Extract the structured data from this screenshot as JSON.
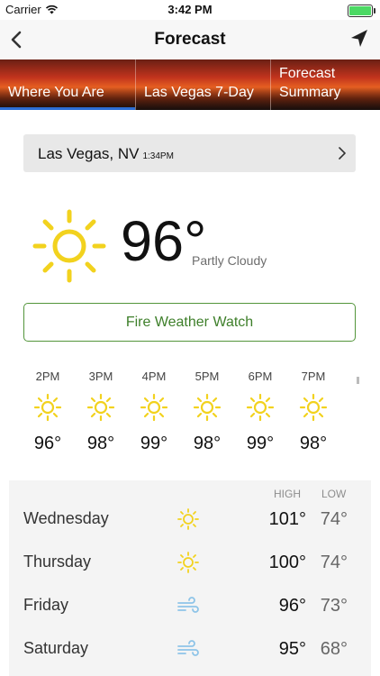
{
  "status": {
    "carrier": "Carrier",
    "time": "3:42 PM"
  },
  "nav": {
    "title": "Forecast"
  },
  "tabs": [
    {
      "label": "Where You Are",
      "active": true
    },
    {
      "label": "Las Vegas 7-Day",
      "active": false
    },
    {
      "label": "Forecast\nSummary",
      "active": false
    }
  ],
  "location": {
    "name": "Las Vegas, NV",
    "time": "1:34PM"
  },
  "current": {
    "temp": "96°",
    "condition": "Partly Cloudy",
    "icon": "sun-icon"
  },
  "alert": {
    "label": "Fire Weather Watch"
  },
  "hourly": [
    {
      "time": "2PM",
      "temp": "96°",
      "icon": "sun-icon"
    },
    {
      "time": "3PM",
      "temp": "98°",
      "icon": "sun-icon"
    },
    {
      "time": "4PM",
      "temp": "99°",
      "icon": "sun-icon"
    },
    {
      "time": "5PM",
      "temp": "98°",
      "icon": "sun-icon"
    },
    {
      "time": "6PM",
      "temp": "99°",
      "icon": "sun-icon"
    },
    {
      "time": "7PM",
      "temp": "98°",
      "icon": "sun-icon"
    }
  ],
  "daily_header": {
    "high": "HIGH",
    "low": "LOW"
  },
  "daily": [
    {
      "day": "Wednesday",
      "high": "101°",
      "low": "74°",
      "icon": "sun-icon"
    },
    {
      "day": "Thursday",
      "high": "100°",
      "low": "74°",
      "icon": "sun-icon"
    },
    {
      "day": "Friday",
      "high": "96°",
      "low": "73°",
      "icon": "wind-icon"
    },
    {
      "day": "Saturday",
      "high": "95°",
      "low": "68°",
      "icon": "wind-icon"
    }
  ],
  "colors": {
    "sun": "#f2d21e",
    "wind": "#8ec4e8",
    "alert_green": "#53953b",
    "tab_active": "#2c6ed5"
  }
}
